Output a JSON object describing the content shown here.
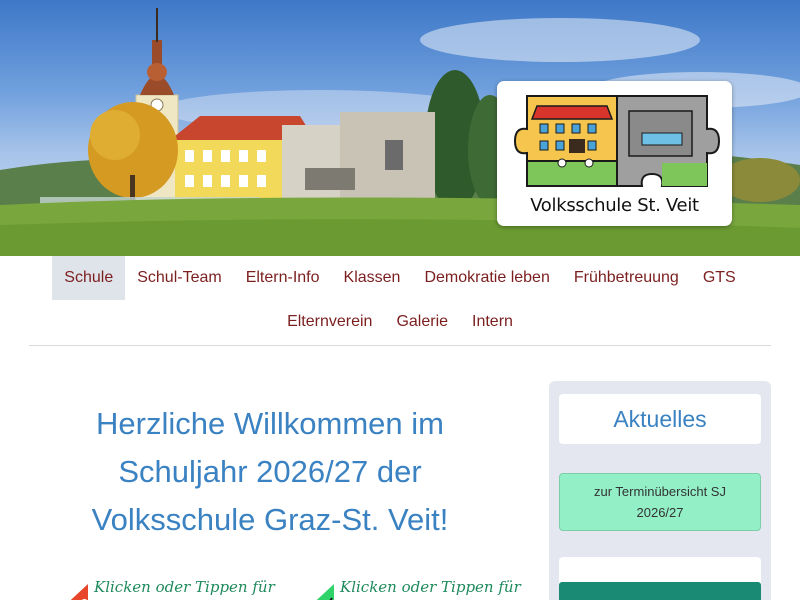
{
  "site": {
    "logo_text": "Volksschule St. Veit"
  },
  "nav": {
    "row1": [
      {
        "label": "Schule",
        "active": true
      },
      {
        "label": "Schul-Team"
      },
      {
        "label": "Eltern-Info"
      },
      {
        "label": "Klassen"
      },
      {
        "label": "Demokratie leben"
      },
      {
        "label": "Frühbetreuung"
      },
      {
        "label": "GTS"
      }
    ],
    "row2": [
      {
        "label": "Elternverein"
      },
      {
        "label": "Galerie"
      },
      {
        "label": "Intern"
      }
    ]
  },
  "main": {
    "welcome_lines": [
      "Herzliche Willkommen im",
      "Schuljahr 2026/27 der",
      "Volksschule Graz-St. Veit!"
    ],
    "links": [
      {
        "label": "Klicken oder Tippen für",
        "flag_color": "#e8462a"
      },
      {
        "label": "Klicken  oder  Tippen  für",
        "flag_color": "#2fd36a"
      }
    ]
  },
  "sidebar": {
    "heading": "Aktuelles",
    "button_line1": "zur Terminübersicht SJ",
    "button_line2": "2026/27"
  },
  "colors": {
    "nav_text": "#7c1f1f",
    "heading_blue": "#3a82c2",
    "button_green": "#93efc6"
  }
}
